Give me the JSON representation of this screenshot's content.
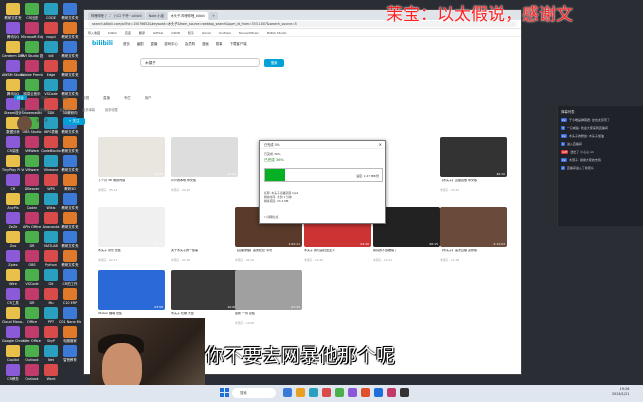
{
  "banner": {
    "text": "茉宝：以太假说，感谢文"
  },
  "subtitle": {
    "text": "你不要去网暴他那个呢"
  },
  "desktop": {
    "icons": [
      {
        "label": "教研文件夹"
      },
      {
        "label": "CR社团"
      },
      {
        "label": "CODE"
      },
      {
        "label": "教研文件夹"
      },
      {
        "label": "腾讯QQ"
      },
      {
        "label": "Microsoft Edge"
      },
      {
        "label": "nogui"
      },
      {
        "label": "教研文件夹"
      },
      {
        "label": "Centerm DPN"
      },
      {
        "label": "DVI Studio 投屏"
      },
      {
        "label": "bili"
      },
      {
        "label": "教研文件夹"
      },
      {
        "label": "AWSM Studio"
      },
      {
        "label": "Adobe Premiere"
      },
      {
        "label": "Edge"
      },
      {
        "label": "教研文件夹"
      },
      {
        "label": "腾讯QQ"
      },
      {
        "label": "网易云音乐"
      },
      {
        "label": "VSCode"
      },
      {
        "label": "教研文件夹"
      },
      {
        "label": "Steam设计"
      },
      {
        "label": "Snowmastic"
      },
      {
        "label": "SDK"
      },
      {
        "label": "3D教研内"
      },
      {
        "label": "数据分析"
      },
      {
        "label": "OBS Studio"
      },
      {
        "label": "WPS表格"
      },
      {
        "label": "教研文件夹"
      },
      {
        "label": "CR讲座"
      },
      {
        "label": "VMWare"
      },
      {
        "label": "CodeBlocks"
      },
      {
        "label": "教研文件夹"
      },
      {
        "label": "TinyPlay Pi Vertex"
      },
      {
        "label": "VMware"
      },
      {
        "label": "Vliveone"
      },
      {
        "label": "教研文件夹"
      },
      {
        "label": "CR"
      },
      {
        "label": "DBeaver"
      },
      {
        "label": "WPS"
      },
      {
        "label": "教研3D"
      },
      {
        "label": "AnyPls"
      },
      {
        "label": "Codec"
      },
      {
        "label": "Wikis"
      },
      {
        "label": "教研文件夹"
      },
      {
        "label": "ZeZe"
      },
      {
        "label": "APIs Office"
      },
      {
        "label": "Anaconda"
      },
      {
        "label": "教研文件夹"
      },
      {
        "label": "Zuo"
      },
      {
        "label": "DR"
      },
      {
        "label": "MATLAB"
      },
      {
        "label": "教研文件夹"
      },
      {
        "label": "Zplex"
      },
      {
        "label": "OBS"
      },
      {
        "label": "Python"
      },
      {
        "label": "教研文件夹"
      },
      {
        "label": "Wire"
      },
      {
        "label": "VSCode"
      },
      {
        "label": "Git"
      },
      {
        "label": "CR的工作"
      },
      {
        "label": "CR工具"
      },
      {
        "label": "DR"
      },
      {
        "label": "Mu"
      },
      {
        "label": "C10 ERP"
      },
      {
        "label": "Cloud Mana..."
      },
      {
        "label": "Office"
      },
      {
        "label": "PPT"
      },
      {
        "label": "C01 Nana Moon"
      },
      {
        "label": "Google Chrome"
      },
      {
        "label": "Wer Office"
      },
      {
        "label": "SkyP"
      },
      {
        "label": "电脑管家"
      },
      {
        "label": "Copilot"
      },
      {
        "label": "Outlook"
      },
      {
        "label": "Net"
      },
      {
        "label": "智慧教育"
      },
      {
        "label": "CR教务"
      },
      {
        "label": "Outlook"
      },
      {
        "label": "Word"
      }
    ]
  },
  "browser": {
    "tabs": [
      {
        "label": "哔哩哔哩 (゜-゜)つロ 干杯~-bilibili"
      },
      {
        "label": "Note 小组"
      },
      {
        "label": "木头子-哔哩哔哩_bilibili"
      },
      {
        "label": "+"
      }
    ],
    "url": "search.bilibili.com/all?vt=15076652&keyword=木头子&from_source=webtop_search&spm_id_from=333.1007&search_source=5",
    "bookmarks": [
      "导入收藏",
      "bilibili",
      "百度",
      "翻译",
      "GitHub",
      "CSDN",
      "知乎",
      "Gmail",
      "YouTube",
      "TencentMusic",
      "Bilibili Studio"
    ],
    "nav": [
      "首页",
      "番剧",
      "直播",
      "游戏中心",
      "会员购",
      "漫画",
      "赛事",
      "下载客户端"
    ],
    "logo": "bilibili",
    "search_value": "木頭子",
    "search_button": "搜索",
    "filters": [
      "综合",
      "视频",
      "番剧",
      "影视",
      "直播",
      "专栏",
      "用户"
    ],
    "active_filter": "综合",
    "subfilters": [
      "综合排序",
      "最多播放",
      "最新发布",
      "最多弹幕",
      "最多收藏"
    ],
    "up_name": "木頭子",
    "follow_label": "+ 关注",
    "videos": [
      {
        "title": "下个月 3D 教研内容",
        "meta": "木頭子 · 05-12",
        "duration": "03:41"
      },
      {
        "title": "卢卢的本地 中文版",
        "meta": "木頭子 · 04-10",
        "duration": "12:20"
      },
      {
        "title": "【木头子】直播回放 中文版",
        "meta": "木頭子 · 03-22",
        "duration": "40:10"
      },
      {
        "title": "木头子 音乐 合集",
        "meta": "木頭子 · 02-17",
        "duration": "05:02"
      },
      {
        "title": "关于木头子的一些事",
        "meta": "木頭子 · 01-30",
        "duration": "08:44"
      },
      {
        "title": "【直播录播】首秀纪念 专访",
        "meta": "木頭子 · 01-02",
        "duration": "1:02:11"
      },
      {
        "title": "木头子 我们是社会主义",
        "meta": "木頭子 · 12-20",
        "duration": "04:30"
      },
      {
        "title": "我真的不会被骗了",
        "meta": "木頭子 · 12-11",
        "duration": "06:15"
      },
      {
        "title": "【木头子】首次直播 完整版",
        "meta": "木頭子 · 11-28",
        "duration": "2:12:03"
      },
      {
        "title": "Vtuber 翻唱 合集",
        "meta": "木頭子 · 11-10",
        "duration": "03:58"
      },
      {
        "title": "木头子 吐槽 大会",
        "meta": "木頭子 · 10-22",
        "duration": "10:06"
      },
      {
        "title": "最新 一周 总结",
        "meta": "木頭子 · 10-05",
        "duration": "07:33"
      }
    ]
  },
  "dialog": {
    "title": "已完成 0%",
    "line1": "已完成 36%",
    "percent_text": "已完成 36%",
    "progress": 0.17,
    "speed": "速度: 1.47 MB/秒",
    "info": [
      "名称: 木头子直播录屏.mp4",
      "剩余时间: 大约 1 分钟",
      "剩余项目: 23.4 MB"
    ],
    "checkbox_label": "简略信息"
  },
  "right_panel": {
    "title": "弹幕列表",
    "messages": [
      {
        "tag": "LV.",
        "text": "于今唯是弹幕君: 这也太厉害了",
        "red": false
      },
      {
        "tag": "3",
        "text": "一只咸鱼: 欢迎大家来到直播间",
        "red": false
      },
      {
        "tag": "LV.",
        "text": "木头子的粉丝: 木头子加油",
        "red": false
      },
      {
        "tag": "1",
        "text": "进入直播间",
        "red": false
      },
      {
        "tag": "Gift",
        "text": "送出了 小心心 x1",
        "red": true
      },
      {
        "tag": "LV.",
        "text": "木頭子: 谢谢大家的支持",
        "red": false
      },
      {
        "tag": "2",
        "text": "直播间进入了新观众",
        "red": false
      }
    ]
  },
  "taskbar": {
    "search_placeholder": "搜索",
    "time": "19:26",
    "date": "2024/1/21"
  }
}
